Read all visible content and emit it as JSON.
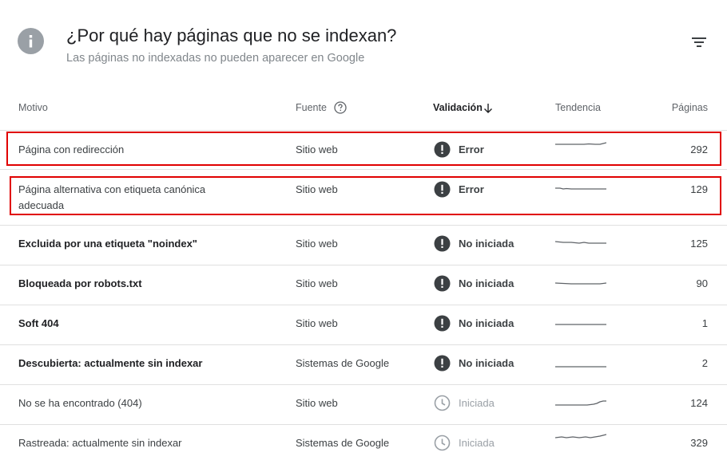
{
  "header": {
    "title": "¿Por qué hay páginas que no se indexan?",
    "subtitle": "Las páginas no indexadas no pueden aparecer en Google",
    "icon": "info-icon",
    "filter_icon": "filter-icon"
  },
  "columns": {
    "motivo": "Motivo",
    "fuente": "Fuente",
    "validacion": "Validación",
    "tendencia": "Tendencia",
    "paginas": "Páginas"
  },
  "rows": [
    {
      "motivo": "Página con redirección",
      "motivo_line2": "",
      "fuente": "Sitio web",
      "validacion": "Error",
      "status_icon": "alert-icon",
      "paginas": "292",
      "highlighted": true
    },
    {
      "motivo": "Página alternativa con etiqueta canónica",
      "motivo_line2": "adecuada",
      "fuente": "Sitio web",
      "validacion": "Error",
      "status_icon": "alert-icon",
      "paginas": "129",
      "highlighted": true
    },
    {
      "motivo": "Excluida por una etiqueta \"noindex\"",
      "motivo_line2": "",
      "fuente": "Sitio web",
      "validacion": "No iniciada",
      "status_icon": "alert-icon",
      "paginas": "125"
    },
    {
      "motivo": "Bloqueada por robots.txt",
      "motivo_line2": "",
      "fuente": "Sitio web",
      "validacion": "No iniciada",
      "status_icon": "alert-icon",
      "paginas": "90"
    },
    {
      "motivo": "Soft 404",
      "motivo_line2": "",
      "fuente": "Sitio web",
      "validacion": "No iniciada",
      "status_icon": "alert-icon",
      "paginas": "1"
    },
    {
      "motivo": "Descubierta: actualmente sin indexar",
      "motivo_line2": "",
      "fuente": "Sistemas de Google",
      "validacion": "No iniciada",
      "status_icon": "alert-icon",
      "paginas": "2"
    },
    {
      "motivo": "No se ha encontrado (404)",
      "motivo_line2": "",
      "fuente": "Sitio web",
      "validacion": "Iniciada",
      "status_icon": "clock-icon",
      "paginas": "124"
    },
    {
      "motivo": "Rastreada: actualmente sin indexar",
      "motivo_line2": "",
      "fuente": "Sistemas de Google",
      "validacion": "Iniciada",
      "status_icon": "clock-icon",
      "paginas": "329"
    }
  ],
  "colors": {
    "alert": "#3c4043",
    "highlight": "#e00000",
    "muted": "#9aa0a6"
  }
}
